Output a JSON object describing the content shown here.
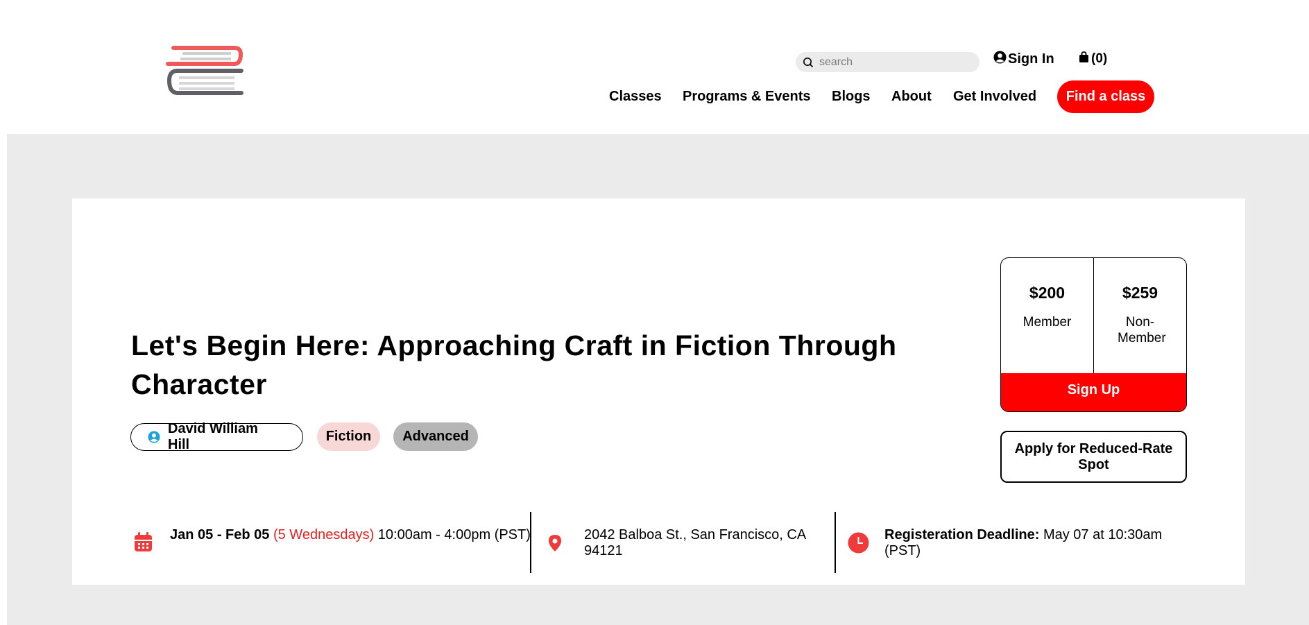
{
  "header": {
    "search_placeholder": "search",
    "sign_in": "Sign In",
    "cart": "(0)",
    "nav": [
      "Classes",
      "Programs & Events",
      "Blogs",
      "About",
      "Get Involved"
    ],
    "cta": "Find a class"
  },
  "class": {
    "title": "Let's Begin Here: Approaching Craft in Fiction Through Character",
    "author": "David William Hill",
    "tags": [
      "Fiction",
      "Advanced"
    ]
  },
  "pricing": {
    "member_price": "$200",
    "member_label": "Member",
    "nonmember_price": "$259",
    "nonmember_label": "Non-Member",
    "signup": "Sign Up",
    "reduced_rate": "Apply for Reduced-Rate Spot"
  },
  "info": {
    "dates": "Jan 05 - Feb 05",
    "sessions": "(5 Wednesdays)",
    "time": "10:00am - 4:00pm (PST)",
    "address": "2042 Balboa St., San Francisco, CA 94121",
    "deadline_label": "Registeration Deadline:",
    "deadline_value": "May 07 at 10:30am (PST)"
  },
  "colors": {
    "accent": "#ff0000",
    "icon_red": "#ef3b3b",
    "band": "#ebebeb",
    "fiction_tag": "#f8d7d7",
    "advanced_tag": "#b5b5b5",
    "author_icon": "#1aa3d9"
  },
  "icons": [
    "books-logo",
    "search-icon",
    "user-circle-icon",
    "shopping-bag-icon",
    "calendar-icon",
    "location-pin-icon",
    "clock-icon"
  ]
}
